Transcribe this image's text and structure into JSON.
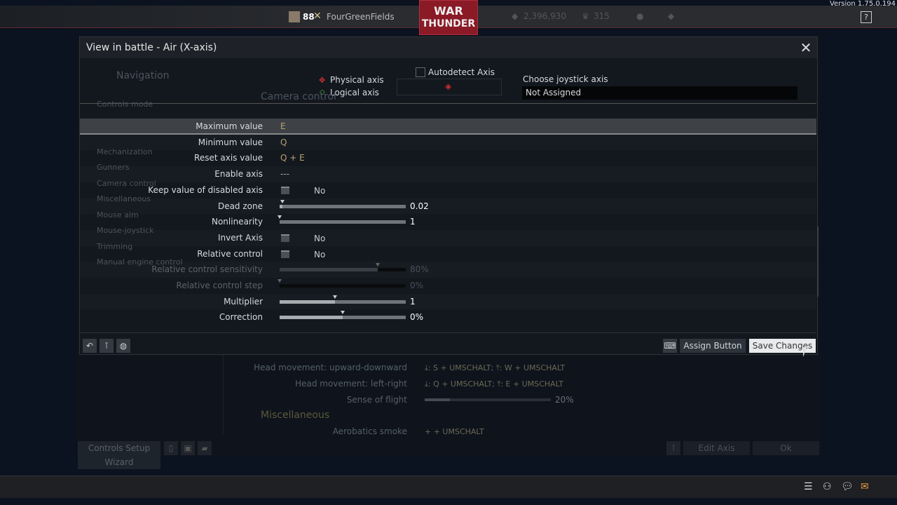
{
  "topbar": {
    "version": "Version 1.75.0.194",
    "level": "88",
    "username": "FourGreenFields",
    "logo_line1": "WAR",
    "logo_line2": "THUNDER",
    "silver_lions": "2,396,930",
    "golden_eagles": "315",
    "help": "?"
  },
  "background": {
    "nav_title": "Navigation",
    "section_title": "Camera control",
    "nav_items": [
      "Controls mode",
      "Mechanization",
      "Gunners",
      "Camera control",
      "Miscellaneous",
      "Mouse aim",
      "Mouse-joystick",
      "Trimming",
      "Manual engine control"
    ],
    "rows": [
      {
        "label": "Head movement: upward-downward",
        "value": "⤓: S + UMSCHALT;  ⤒: W + UMSCHALT"
      },
      {
        "label": "Head movement: left-right",
        "value": "⤓: Q + UMSCHALT;  ⤒: E + UMSCHALT"
      },
      {
        "label": "Sense of flight",
        "value": "20%",
        "slider": 0.2
      }
    ],
    "misc_title": "Miscellaneous",
    "misc_rows": [
      {
        "label": "Aerobatics smoke",
        "value": "+ + UMSCHALT"
      }
    ],
    "footer": {
      "wizard": "Controls Setup Wizard",
      "edit_axis": "Edit Axis",
      "ok": "Ok"
    }
  },
  "dialog": {
    "title": "View in battle - Air (X-axis)",
    "close": "✕",
    "physical_axis": "Physical axis",
    "logical_axis": "Logical axis",
    "autodetect": "Autodetect Axis",
    "choose_joystick_label": "Choose joystick axis",
    "choose_joystick_value": "Not Assigned",
    "rows": [
      {
        "label": "Maximum value",
        "type": "key",
        "value": "E"
      },
      {
        "label": "Minimum value",
        "type": "key",
        "value": "Q"
      },
      {
        "label": "Reset axis value",
        "type": "key",
        "value": "Q + E"
      },
      {
        "label": "Enable axis",
        "type": "text",
        "value": "---"
      },
      {
        "label": "Keep value of disabled axis",
        "type": "check",
        "value": "No"
      },
      {
        "label": "Dead zone",
        "type": "slider",
        "value": "0.02",
        "level": 0.02
      },
      {
        "label": "Nonlinearity",
        "type": "slider",
        "value": "1",
        "level": 0.0
      },
      {
        "label": "Invert Axis",
        "type": "check",
        "value": "No"
      },
      {
        "label": "Relative control",
        "type": "check",
        "value": "No"
      },
      {
        "label": "Relative control sensitivity",
        "type": "slider",
        "value": "80%",
        "level": 0.78,
        "disabled": true
      },
      {
        "label": "Relative control step",
        "type": "slider",
        "value": "0%",
        "level": 0.0,
        "disabled": true
      },
      {
        "label": "Multiplier",
        "type": "slider",
        "value": "1",
        "level": 0.44
      },
      {
        "label": "Correction",
        "type": "slider",
        "value": "0%",
        "level": 0.5
      }
    ],
    "assign_button": "Assign Button",
    "save_changes": "Save Changes"
  }
}
